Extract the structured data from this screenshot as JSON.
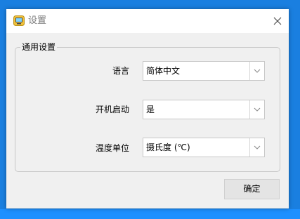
{
  "window": {
    "title": "设置",
    "app_icon": "app-settings-icon",
    "close_icon": "close-icon"
  },
  "group": {
    "legend": "通用设置",
    "rows": [
      {
        "label": "语言",
        "value": "简体中文",
        "arrow_icon": "chevron-down-icon"
      },
      {
        "label": "开机启动",
        "value": "是",
        "arrow_icon": "chevron-down-icon"
      },
      {
        "label": "温度单位",
        "value": "摄氏度 (℃)",
        "arrow_icon": "chevron-down-icon"
      }
    ]
  },
  "footer": {
    "ok_label": "确定"
  },
  "colors": {
    "desktop": "#1a7fe0",
    "window_bg": "#f0f0f0",
    "titlebar_bg": "#ffffff",
    "button_bg": "#e4e4e4"
  }
}
